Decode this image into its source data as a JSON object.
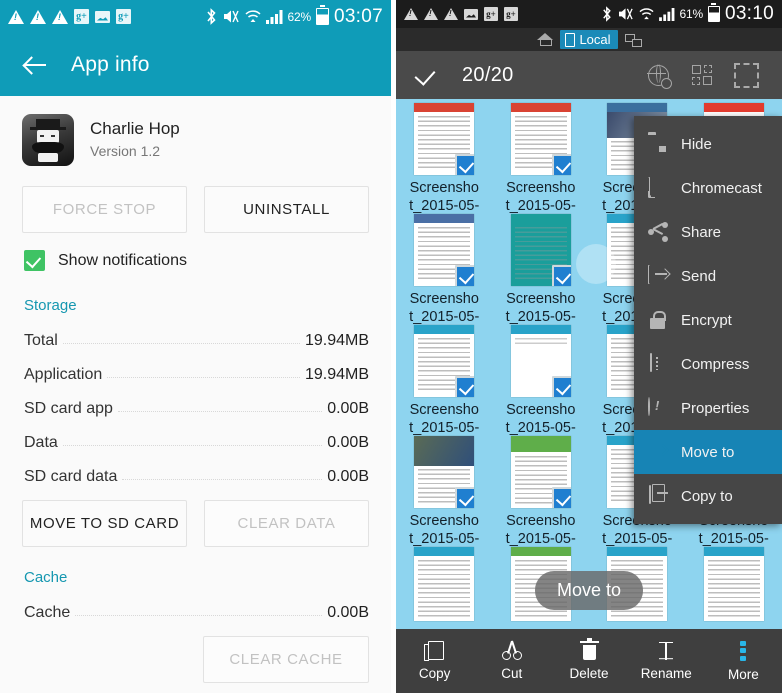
{
  "left_panel": {
    "status_bar": {
      "icons": [
        "warning-triangle-icon",
        "warning-triangle-icon",
        "warning-triangle-icon",
        "google-plus-icon",
        "photo-icon",
        "google-plus-icon",
        "bluetooth-icon",
        "mute-icon",
        "wifi-icon",
        "signal-icon"
      ],
      "battery_percent": "62%",
      "time": "03:07"
    },
    "appbar": {
      "back_icon": "back-arrow-icon",
      "title": "App info"
    },
    "app": {
      "name": "Charlie Hop",
      "version": "Version 1.2",
      "icon": "charlie-hop-app-icon"
    },
    "buttons": {
      "force_stop": "FORCE STOP",
      "uninstall": "UNINSTALL"
    },
    "notifications": {
      "label": "Show notifications",
      "checked": true
    },
    "storage": {
      "section_title": "Storage",
      "rows": [
        {
          "label": "Total",
          "value": "19.94MB"
        },
        {
          "label": "Application",
          "value": "19.94MB"
        },
        {
          "label": "SD card app",
          "value": "0.00B"
        },
        {
          "label": "Data",
          "value": "0.00B"
        },
        {
          "label": "SD card data",
          "value": "0.00B"
        }
      ],
      "buttons": {
        "move_to_sd": "MOVE TO SD CARD",
        "clear_data": "CLEAR DATA"
      }
    },
    "cache": {
      "section_title": "Cache",
      "rows": [
        {
          "label": "Cache",
          "value": "0.00B"
        }
      ],
      "buttons": {
        "clear_cache": "CLEAR CACHE"
      }
    },
    "colors": {
      "accent": "#0f9cb8",
      "section_heading": "#1597b0",
      "checkbox": "#3fc364"
    }
  },
  "right_panel": {
    "status_bar": {
      "icons": [
        "warning-triangle-icon",
        "warning-triangle-icon",
        "warning-triangle-icon",
        "photo-icon",
        "google-plus-icon",
        "google-plus-icon",
        "bluetooth-icon",
        "mute-icon",
        "wifi-icon",
        "signal-icon"
      ],
      "battery_percent": "61%",
      "time": "03:10"
    },
    "tabs": {
      "home": "home-icon",
      "active": "Local",
      "network": "network-icon"
    },
    "action_bar": {
      "select_all_icon": "checkmark-icon",
      "count": "20/20",
      "icons": [
        "globe-search-icon",
        "select-items-icon",
        "select-all-icon"
      ]
    },
    "grid": {
      "filename_line1": "Screensho",
      "filename_line2": "t_2015-05-",
      "columns": 4,
      "rows": 5,
      "all_selected": true,
      "thumbnails": [
        {
          "bar": "#d94333",
          "kind": "text"
        },
        {
          "bar": "#d94333",
          "kind": "text"
        },
        {
          "bar": "#3b6f9e",
          "kind": "photo"
        },
        {
          "bar": "#e33b2e",
          "kind": "text"
        },
        {
          "bar": "#4a6fa5",
          "kind": "text"
        },
        {
          "bar": "#1a9e9b",
          "kind": "teal"
        },
        {
          "bar": "#29a3c9",
          "kind": "text"
        },
        {
          "bar": "#29a3c9",
          "kind": "text"
        },
        {
          "bar": "#29a3c9",
          "kind": "list"
        },
        {
          "bar": "#ffffff",
          "kind": "blank"
        },
        {
          "bar": "#29a3c9",
          "kind": "text"
        },
        {
          "bar": "#29a3c9",
          "kind": "text"
        },
        {
          "bar": "#6f6f6f",
          "kind": "photo"
        },
        {
          "bar": "#5fae4a",
          "kind": "list"
        },
        {
          "bar": "#29a3c9",
          "kind": "text"
        },
        {
          "bar": "#29a3c9",
          "kind": "text"
        },
        {
          "bar": "#29a3c9",
          "kind": "text"
        },
        {
          "bar": "#5fae4a",
          "kind": "list"
        },
        {
          "bar": "#29a3c9",
          "kind": "text"
        },
        {
          "bar": "#29a3c9",
          "kind": "text"
        }
      ]
    },
    "context_menu": {
      "items": [
        {
          "label": "Hide",
          "icon": "hide-folder-icon",
          "active": false
        },
        {
          "label": "Chromecast",
          "icon": "chromecast-icon",
          "active": false
        },
        {
          "label": "Share",
          "icon": "share-icon",
          "active": false
        },
        {
          "label": "Send",
          "icon": "send-icon",
          "active": false
        },
        {
          "label": "Encrypt",
          "icon": "lock-icon",
          "active": false
        },
        {
          "label": "Compress",
          "icon": "compress-icon",
          "active": false
        },
        {
          "label": "Properties",
          "icon": "info-icon",
          "active": false
        },
        {
          "label": "Move to",
          "icon": "move-to-icon",
          "active": true
        },
        {
          "label": "Copy to",
          "icon": "copy-to-icon",
          "active": false
        }
      ]
    },
    "toast": "Move to",
    "bottom_bar": [
      {
        "label": "Copy",
        "icon": "copy-icon"
      },
      {
        "label": "Cut",
        "icon": "scissors-icon"
      },
      {
        "label": "Delete",
        "icon": "trash-icon"
      },
      {
        "label": "Rename",
        "icon": "text-cursor-icon"
      },
      {
        "label": "More",
        "icon": "more-dots-icon"
      }
    ],
    "colors": {
      "selection_bg": "#8ed4ef",
      "menu_active": "#1784b5",
      "tab_active": "#1b8ab8",
      "more_accent": "#29b6e8"
    }
  }
}
